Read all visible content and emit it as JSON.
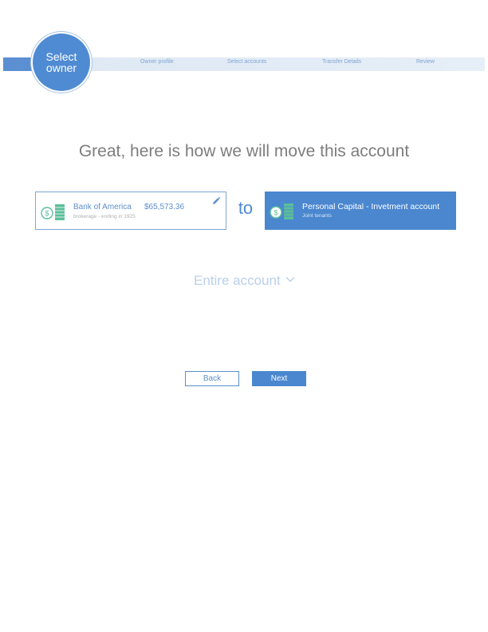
{
  "stepper": {
    "current_step": "Select owner",
    "steps": [
      "Owner profile",
      "Select accounts",
      "Transfer Details",
      "Review"
    ]
  },
  "heading": "Great, here is how we will move this account",
  "from_account": {
    "icon": "money-icon",
    "name": "Bank of America",
    "amount": "$65,573.36",
    "subtitle": "brokerage - ending in 1925",
    "edit_icon": "pencil-icon"
  },
  "connector": "to",
  "to_account": {
    "icon": "money-icon",
    "name": "Personal Capital - Invetment account",
    "subtitle": "Joint tenants"
  },
  "transfer_amount": {
    "selected": "Entire account",
    "icon": "chevron-down-icon"
  },
  "buttons": {
    "back": "Back",
    "next": "Next"
  },
  "colors": {
    "accent": "#4a87cf",
    "money_green": "#5bbf9a"
  }
}
